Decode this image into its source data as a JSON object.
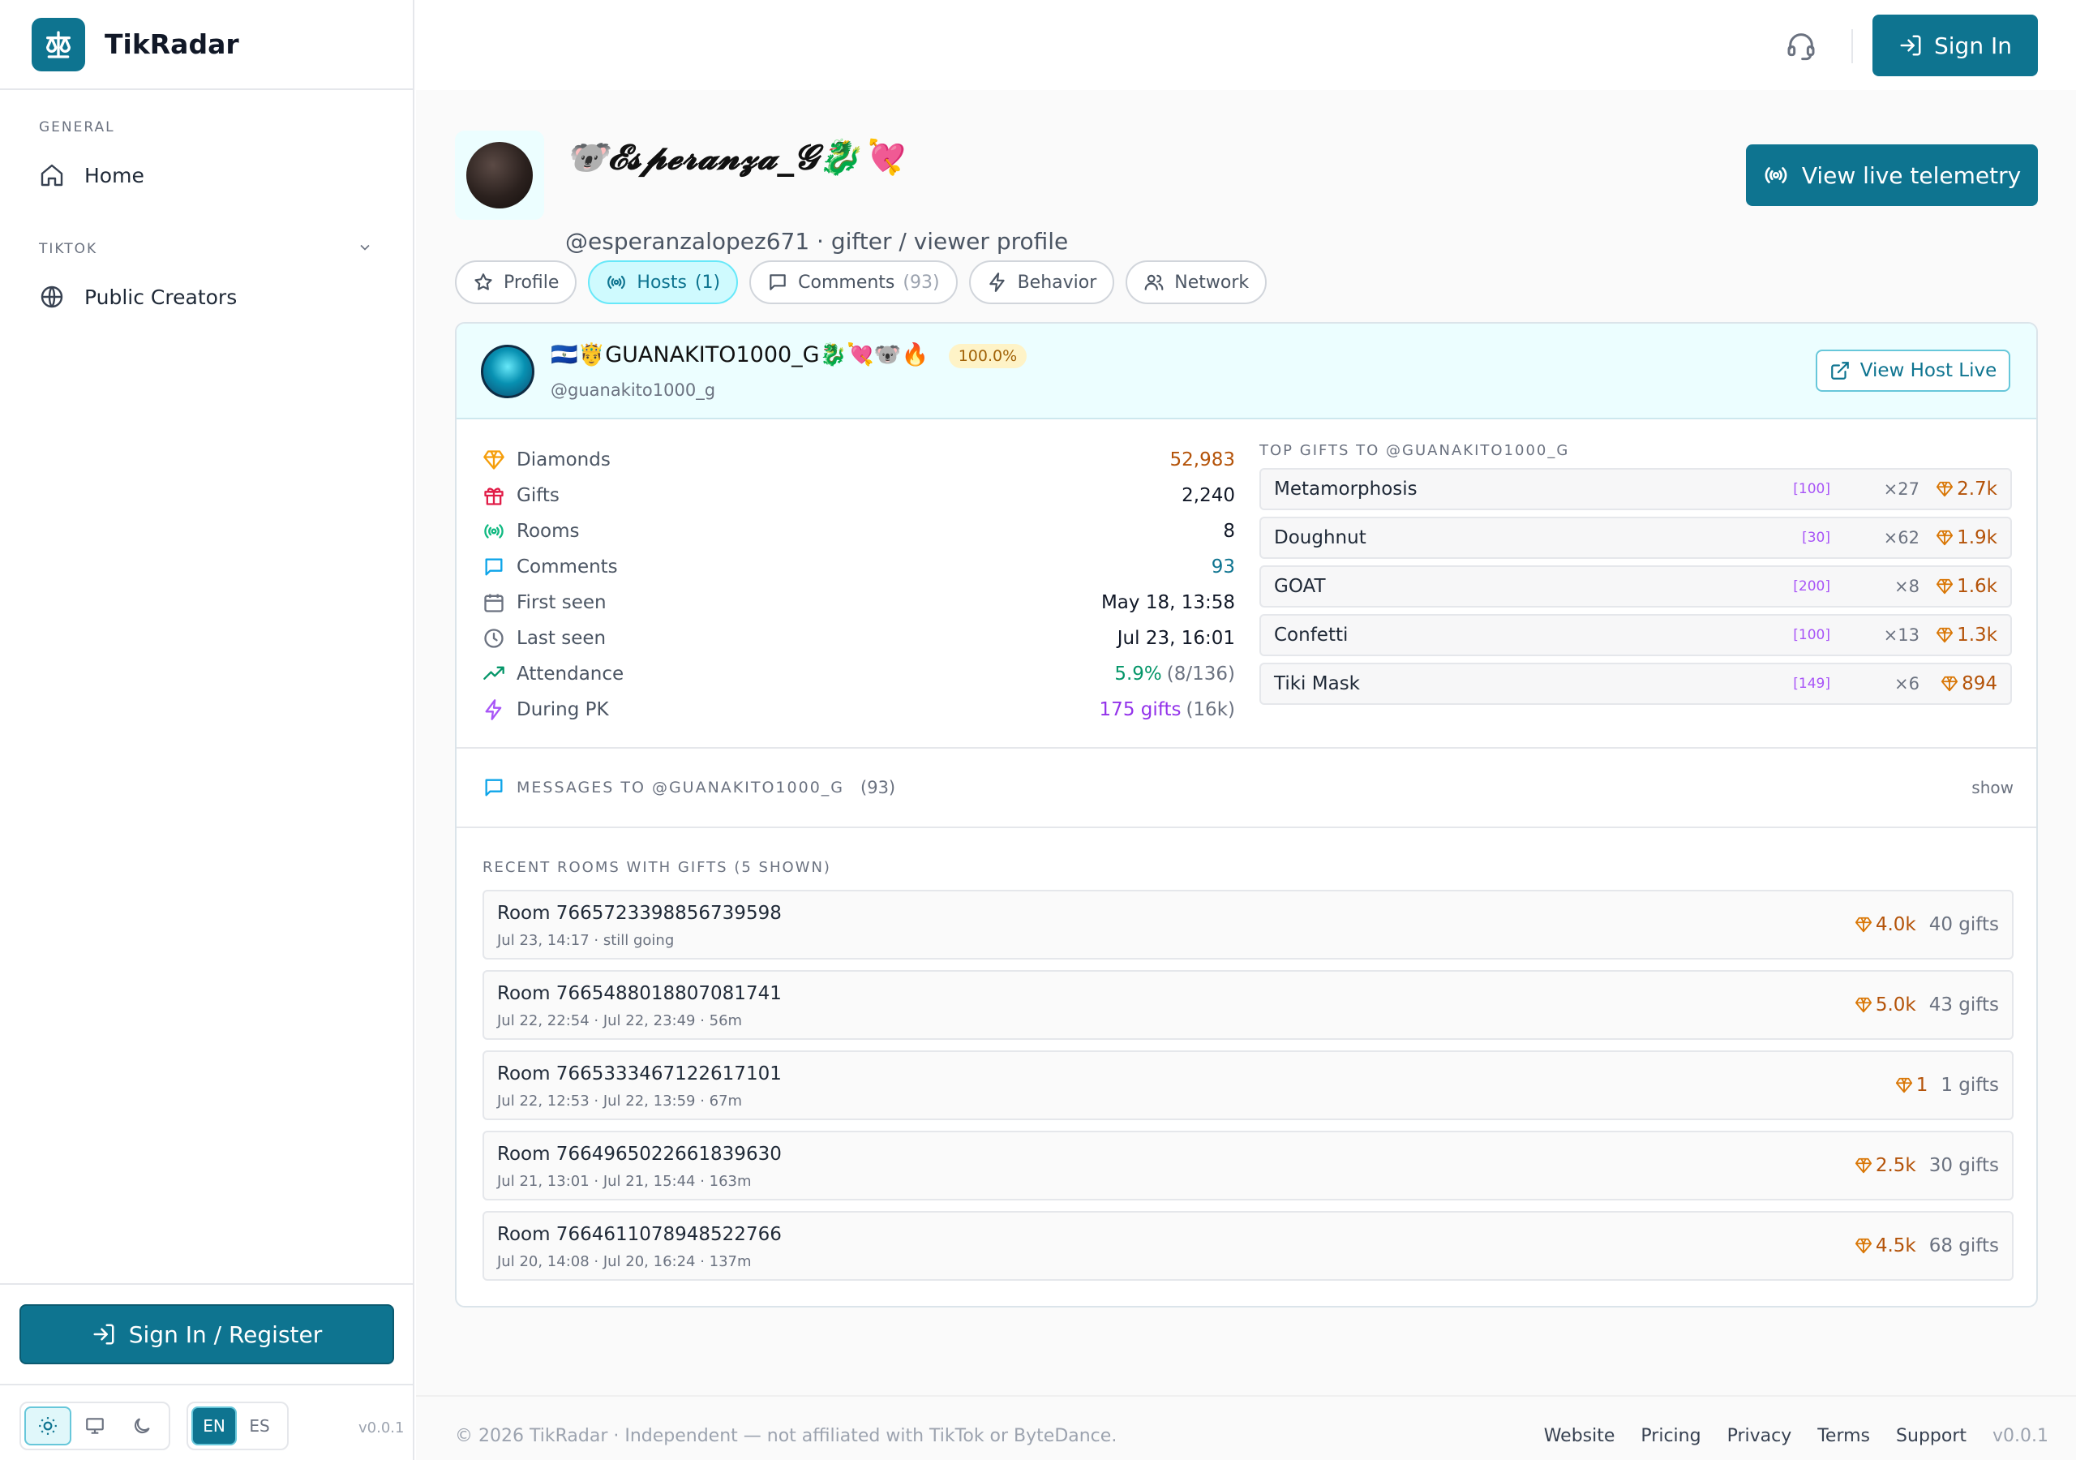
{
  "app": {
    "name": "TikRadar",
    "version": "v0.0.1"
  },
  "sidebar": {
    "general_label": "GENERAL",
    "home_label": "Home",
    "tiktok_label": "TIKTOK",
    "creators_label": "Public Creators",
    "signin_register_label": "Sign In / Register",
    "lang_en": "EN",
    "lang_es": "ES",
    "theme_selected": "light"
  },
  "topbar": {
    "signin_label": "Sign In"
  },
  "profile": {
    "display_name": "🐨𝓔𝓼𝓹𝓮𝓻𝓪𝓷𝔃𝓪_𝓖🐉💘",
    "handle_line": "@esperanzalopez671 · gifter / viewer profile",
    "telemetry_label": "View live telemetry"
  },
  "tabs": [
    {
      "label": "Profile",
      "count": ""
    },
    {
      "label": "Hosts",
      "count": "(1)"
    },
    {
      "label": "Comments",
      "count": "(93)"
    },
    {
      "label": "Behavior",
      "count": ""
    },
    {
      "label": "Network",
      "count": ""
    }
  ],
  "host": {
    "name": "🇸🇻🤴GUANAKITO1000_G🐉💘🐨🔥",
    "badge": "100.0%",
    "handle": "@guanakito1000_g",
    "live_label": "View Host Live",
    "stats": [
      {
        "label": "Diamonds",
        "value": "52,983",
        "sub": ""
      },
      {
        "label": "Gifts",
        "value": "2,240",
        "sub": ""
      },
      {
        "label": "Rooms",
        "value": "8",
        "sub": ""
      },
      {
        "label": "Comments",
        "value": "93",
        "sub": ""
      },
      {
        "label": "First seen",
        "value": "May 18, 13:58",
        "sub": ""
      },
      {
        "label": "Last seen",
        "value": "Jul 23, 16:01",
        "sub": ""
      },
      {
        "label": "Attendance",
        "value": "5.9%",
        "sub": "(8/136)"
      },
      {
        "label": "During PK",
        "value": "175 gifts",
        "sub": "(16k)"
      }
    ],
    "top_gifts_title": "TOP GIFTS TO @GUANAKITO1000_G",
    "top_gifts": [
      {
        "name": "Metamorphosis",
        "price": "[100]",
        "count": "×27",
        "diamonds": "2.7k"
      },
      {
        "name": "Doughnut",
        "price": "[30]",
        "count": "×62",
        "diamonds": "1.9k"
      },
      {
        "name": "GOAT",
        "price": "[200]",
        "count": "×8",
        "diamonds": "1.6k"
      },
      {
        "name": "Confetti",
        "price": "[100]",
        "count": "×13",
        "diamonds": "1.3k"
      },
      {
        "name": "Tiki Mask",
        "price": "[149]",
        "count": "×6",
        "diamonds": "894"
      }
    ],
    "messages_label": "MESSAGES TO @GUANAKITO1000_G",
    "messages_count": "(93)",
    "messages_show": "show",
    "rooms_title": "RECENT ROOMS WITH GIFTS (5 SHOWN)",
    "rooms": [
      {
        "title": "Room 7665723398856739598",
        "time": "Jul 23, 14:17 · still going",
        "diamonds": "4.0k",
        "gifts": "40 gifts"
      },
      {
        "title": "Room 7665488018807081741",
        "time": "Jul 22, 22:54 · Jul 22, 23:49 · 56m",
        "diamonds": "5.0k",
        "gifts": "43 gifts"
      },
      {
        "title": "Room 7665333467122617101",
        "time": "Jul 22, 12:53 · Jul 22, 13:59 · 67m",
        "diamonds": "1",
        "gifts": "1 gifts"
      },
      {
        "title": "Room 7664965022661839630",
        "time": "Jul 21, 13:01 · Jul 21, 15:44 · 163m",
        "diamonds": "2.5k",
        "gifts": "30 gifts"
      },
      {
        "title": "Room 7664611078948522766",
        "time": "Jul 20, 14:08 · Jul 20, 16:24 · 137m",
        "diamonds": "4.5k",
        "gifts": "68 gifts"
      }
    ]
  },
  "footer": {
    "copyright": "© 2026 TikRadar · Independent — not affiliated with TikTok or ByteDance.",
    "links": [
      "Website",
      "Pricing",
      "Privacy",
      "Terms",
      "Support"
    ],
    "version": "v0.0.1"
  },
  "colors": {
    "primary": "#0e7490",
    "diamond": "#b45309",
    "attendance": "#059669",
    "pk": "#9333ea",
    "comments": "#0e7490"
  }
}
